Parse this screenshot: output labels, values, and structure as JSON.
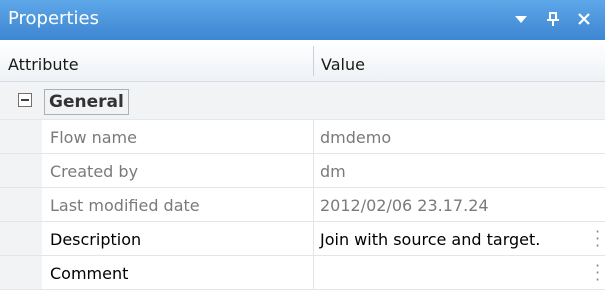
{
  "window": {
    "title": "Properties"
  },
  "columns": {
    "attribute": "Attribute",
    "value": "Value"
  },
  "category": {
    "label": "General"
  },
  "rows": [
    {
      "name": "Flow name",
      "value": "dmdemo",
      "readonly": true
    },
    {
      "name": "Created by",
      "value": "dm",
      "readonly": true
    },
    {
      "name": "Last modified date",
      "value": "2012/02/06 23.17.24",
      "readonly": true
    },
    {
      "name": "Description",
      "value": "Join with source and target.",
      "readonly": false
    },
    {
      "name": "Comment",
      "value": "",
      "readonly": false
    }
  ],
  "icons": [
    "dropdown-icon",
    "pin-icon",
    "close-icon",
    "collapse-icon",
    "ellipsis-icon"
  ],
  "colors": {
    "titlebar": "#3d86d2",
    "title_text": "#ffffff",
    "readonly_text": "#7a7a7a"
  }
}
